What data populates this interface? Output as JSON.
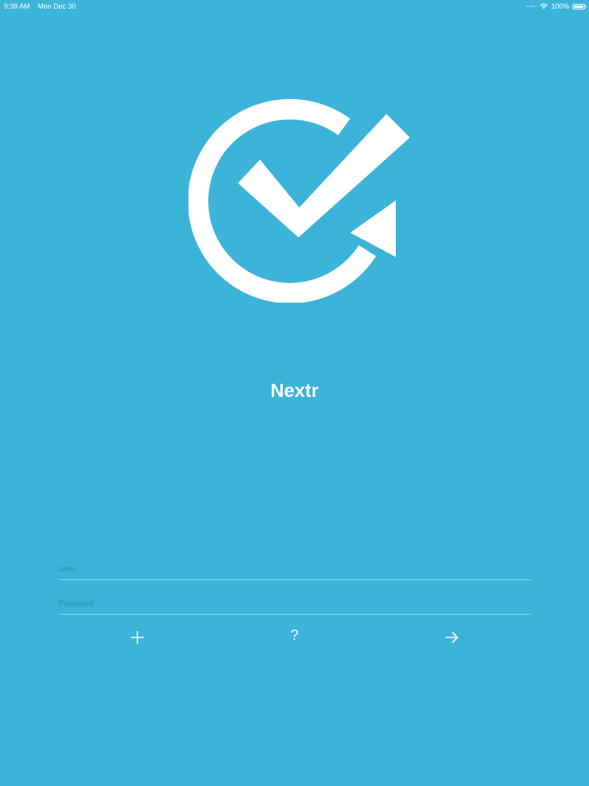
{
  "status_bar": {
    "time": "9:38 AM",
    "date": "Mon Dec 30",
    "battery": "100%",
    "battery_level": 1.0
  },
  "app": {
    "title": "Nextr",
    "logo_icon": "check-refresh-logo-icon"
  },
  "form": {
    "user_placeholder": "User",
    "user_value": "",
    "password_placeholder": "Password",
    "password_value": ""
  },
  "actions": {
    "add_icon": "plus-icon",
    "help_label": "?",
    "next_icon": "arrow-right-icon"
  },
  "colors": {
    "background": "#3cb4d9",
    "foreground": "#ffffff"
  }
}
